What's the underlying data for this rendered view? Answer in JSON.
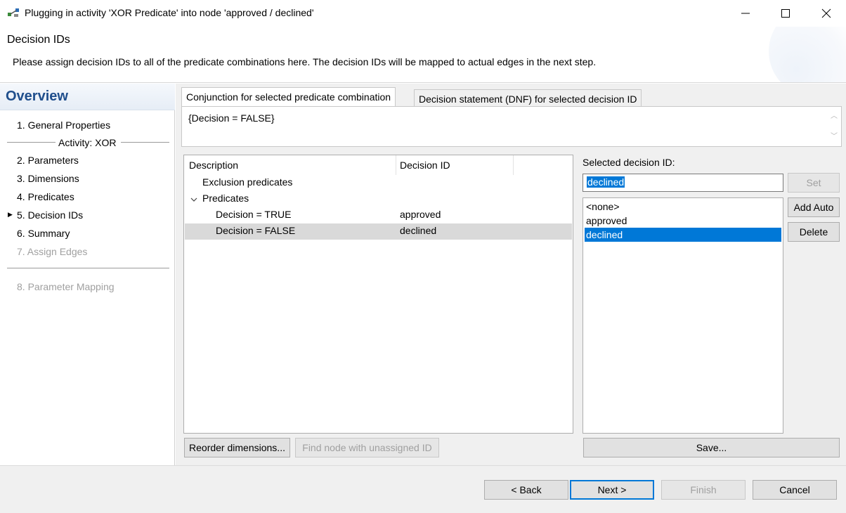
{
  "window": {
    "title": "Plugging in activity 'XOR Predicate' into node 'approved / declined'",
    "minimize": "—",
    "maximize": "☐",
    "close": "✕"
  },
  "header": {
    "title": "Decision IDs",
    "description": "Please assign decision IDs to all of the predicate combinations here. The decision IDs will be mapped to actual edges in the next step."
  },
  "nav": {
    "heading": "Overview",
    "items": [
      {
        "label": "1. General Properties",
        "enabled": true
      },
      {
        "label": "2. Parameters",
        "enabled": true
      },
      {
        "label": "3. Dimensions",
        "enabled": true
      },
      {
        "label": "4. Predicates",
        "enabled": true
      },
      {
        "label": "5. Decision IDs",
        "enabled": true,
        "current": true
      },
      {
        "label": "6. Summary",
        "enabled": true
      },
      {
        "label": "7. Assign Edges",
        "enabled": false
      },
      {
        "label": "8. Parameter Mapping",
        "enabled": false
      }
    ],
    "activity_label": "Activity: XOR",
    "current_marker": "▶"
  },
  "tabs": [
    {
      "label": "Conjunction for selected predicate combination",
      "active": true
    },
    {
      "label": "Decision statement (DNF) for selected decision ID",
      "active": false
    }
  ],
  "conjunction_text": "{Decision = FALSE}",
  "table": {
    "columns": [
      "Description",
      "Decision ID"
    ],
    "rows": [
      {
        "description": "Exclusion predicates",
        "decision_id": "",
        "level": 1
      },
      {
        "description": "Predicates",
        "decision_id": "",
        "level": 1,
        "expanded": true
      },
      {
        "description": "Decision = TRUE",
        "decision_id": "approved",
        "level": 2
      },
      {
        "description": "Decision = FALSE",
        "decision_id": "declined",
        "level": 2,
        "selected": true
      }
    ]
  },
  "selected_decision": {
    "label": "Selected decision ID:",
    "value": "declined",
    "options": [
      "<none>",
      "approved",
      "declined"
    ],
    "selected_option": "declined"
  },
  "buttons": {
    "set": "Set",
    "add_auto": "Add Auto",
    "delete": "Delete",
    "reorder": "Reorder dimensions...",
    "find_node": "Find node with unassigned ID",
    "save": "Save...",
    "back": "< Back",
    "next": "Next >",
    "finish": "Finish",
    "cancel": "Cancel"
  },
  "colors": {
    "accent": "#0078d7",
    "heading": "#1f4e8c",
    "disabled_text": "#a0a0a0",
    "selected_row": "#d9d9d9"
  }
}
